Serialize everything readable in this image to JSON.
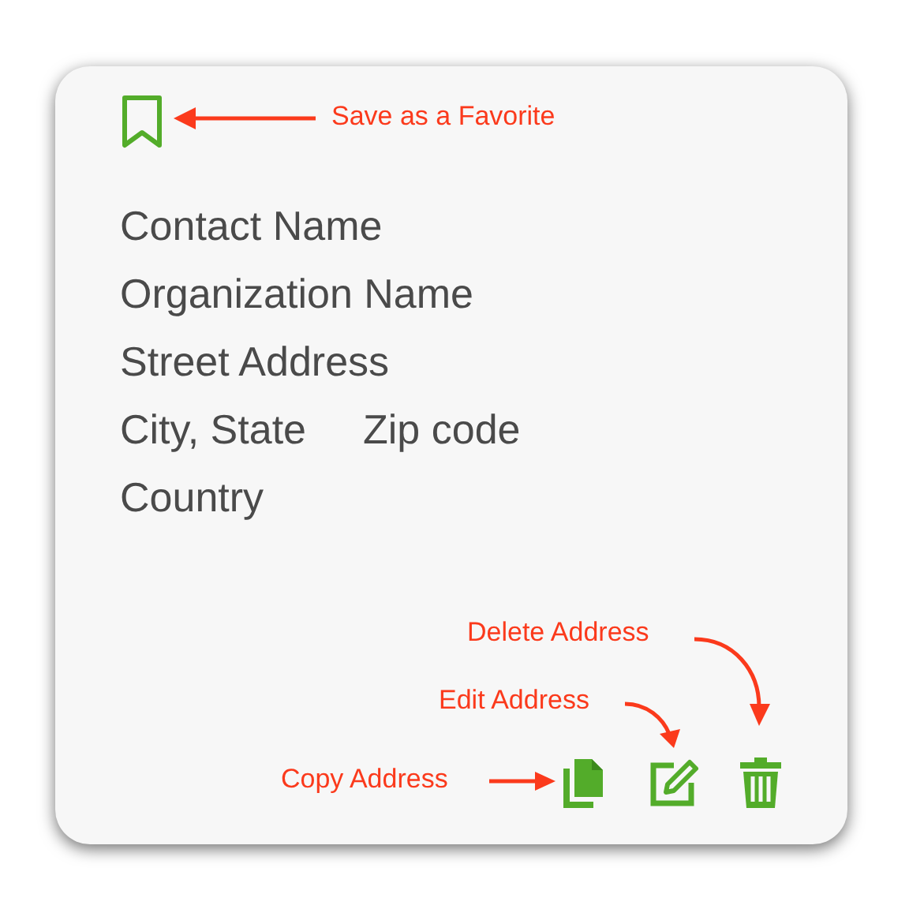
{
  "favorite": {
    "callout": "Save as a Favorite"
  },
  "address_lines": [
    [
      "Contact Name"
    ],
    [
      "Organization Name"
    ],
    [
      "Street Address"
    ],
    [
      "City, State",
      "Zip code"
    ],
    [
      "Country"
    ]
  ],
  "actions": [
    {
      "kind": "copy",
      "callout": "Copy Address"
    },
    {
      "kind": "edit",
      "callout": "Edit Address"
    },
    {
      "kind": "delete",
      "callout": "Delete Address"
    }
  ]
}
